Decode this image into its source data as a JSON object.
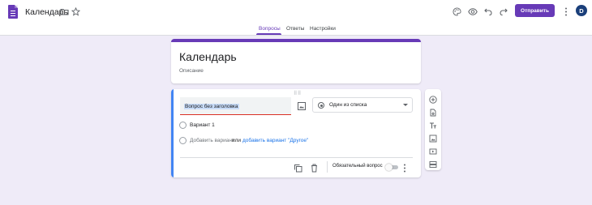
{
  "header": {
    "title": "Календарь",
    "send_label": "Отправить",
    "avatar_letter": "D"
  },
  "tabs": [
    {
      "label": "Вопросы",
      "active": true
    },
    {
      "label": "Ответы",
      "active": false
    },
    {
      "label": "Настройки",
      "active": false
    }
  ],
  "form": {
    "title": "Календарь",
    "description_placeholder": "Описание"
  },
  "question": {
    "title": "Вопрос без заголовка",
    "type": "Один из списка",
    "options": [
      {
        "label": "Вариант 1"
      }
    ],
    "add_option": "Добавить вариант",
    "or_text": "или",
    "add_other": "добавить вариант \"Другое\"",
    "required_label": "Обязательный вопрос",
    "required": false
  },
  "colors": {
    "accent": "#673ab7",
    "focus": "#4285f4",
    "background": "#efebf8"
  },
  "icons": {
    "header": [
      "folder-icon",
      "star-icon",
      "palette-icon",
      "eye-preview-icon",
      "undo-icon",
      "redo-icon",
      "more-vert-icon"
    ],
    "side_toolbar": [
      "add-question-icon",
      "import-questions-icon",
      "add-title-icon",
      "add-image-icon",
      "add-video-icon",
      "add-section-icon"
    ],
    "footer": [
      "duplicate-icon",
      "delete-icon",
      "more-vert-icon"
    ]
  }
}
